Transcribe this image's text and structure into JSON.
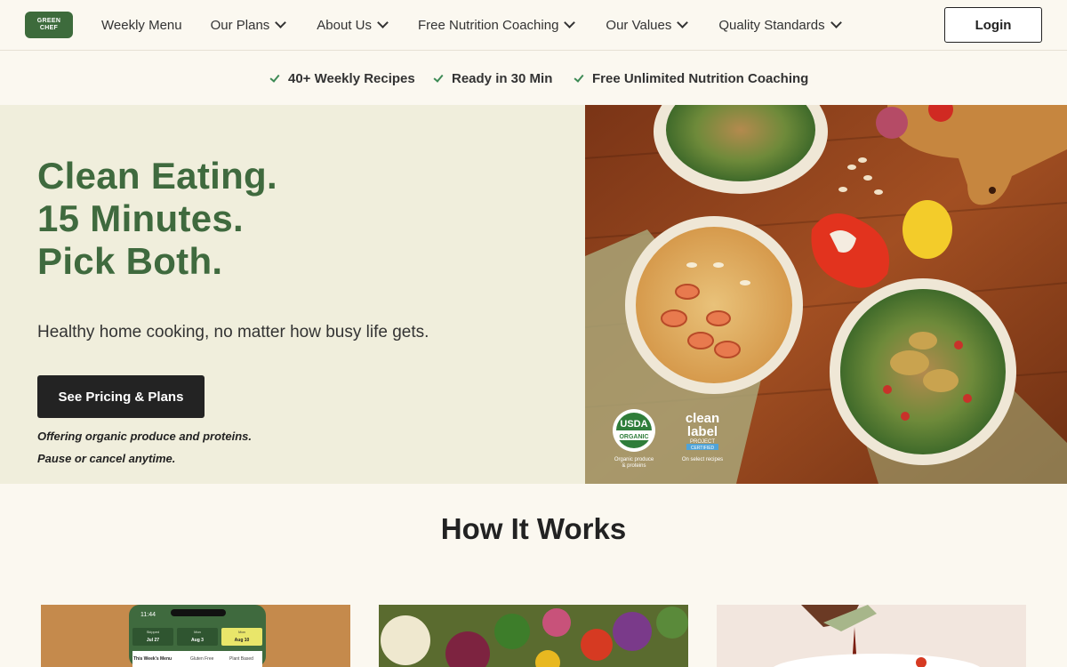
{
  "nav": {
    "logo_line1": "GREEN",
    "logo_line2": "CHEF",
    "items": [
      {
        "label": "Weekly Menu",
        "dropdown": false
      },
      {
        "label": "Our Plans",
        "dropdown": true
      },
      {
        "label": "About Us",
        "dropdown": true
      },
      {
        "label": "Free Nutrition Coaching",
        "dropdown": true
      },
      {
        "label": "Our Values",
        "dropdown": true
      },
      {
        "label": "Quality Standards",
        "dropdown": true
      }
    ],
    "login_label": "Login"
  },
  "benefits": [
    "40+ Weekly Recipes",
    "Ready in 30 Min",
    "Free Unlimited Nutrition Coaching"
  ],
  "hero": {
    "headline": [
      "Clean Eating.",
      "15 Minutes.",
      "Pick Both."
    ],
    "subtitle": "Healthy home cooking, no matter how busy life gets.",
    "cta_label": "See Pricing & Plans",
    "notes": [
      "Offering organic produce and proteins.",
      "Pause or cancel anytime."
    ],
    "badges": {
      "usda_top": "USDA",
      "usda_bottom": "ORGANIC",
      "usda_caption_1": "Organic produce",
      "usda_caption_2": "& proteins",
      "clean_1": "clean",
      "clean_2": "label",
      "clean_3": "PROJECT",
      "clean_4": "CERTIFIED",
      "clean_caption": "On select recipes"
    }
  },
  "how_it_works": {
    "title": "How It Works",
    "phone": {
      "time": "11:44",
      "days": [
        {
          "top": "Skipped",
          "bottom": "Jul 27"
        },
        {
          "top": "Mon",
          "bottom": "Aug 3"
        },
        {
          "top": "Mon",
          "bottom": "Aug 10"
        }
      ],
      "tabs": [
        "This Week's Menu",
        "Gluten Free",
        "Plant Based"
      ]
    }
  },
  "colors": {
    "brand_green": "#3f6a3e",
    "hero_bg": "#f0eedc",
    "page_bg": "#fbf8f0",
    "cta_bg": "#232323",
    "check_green": "#3d8a55"
  }
}
